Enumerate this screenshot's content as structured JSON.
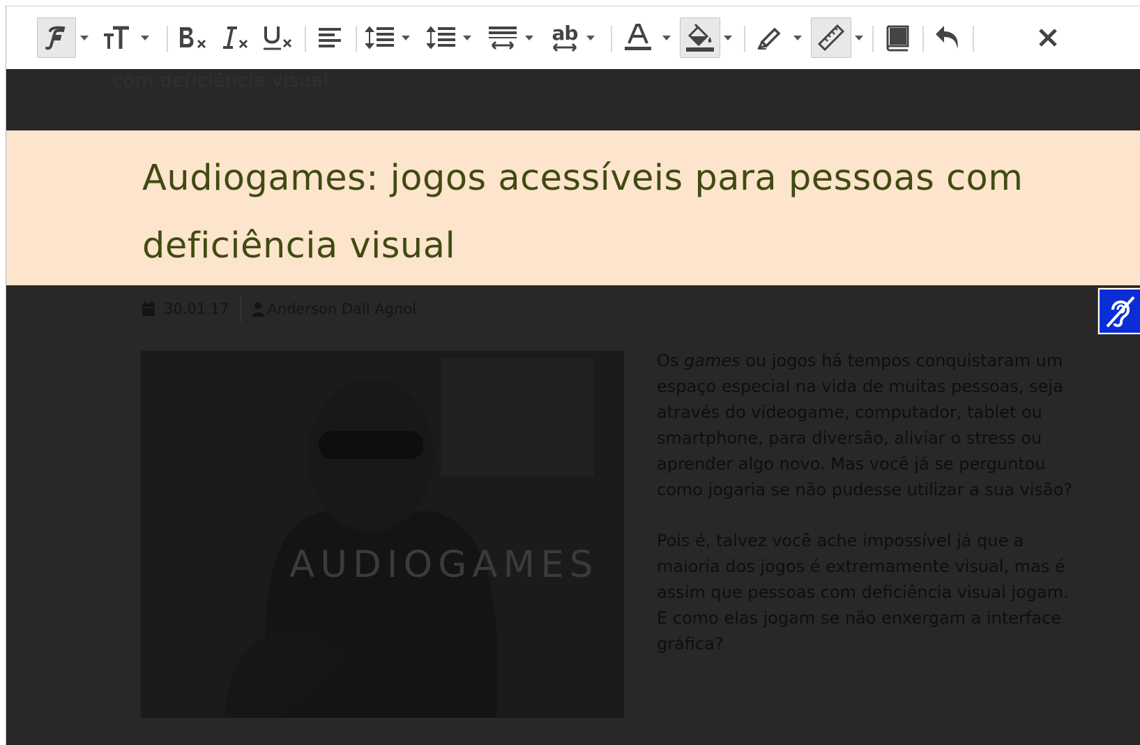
{
  "toolbar": {
    "buttons": [
      {
        "name": "font-family-button",
        "icon": "font-family-icon"
      },
      {
        "name": "font-size-button",
        "icon": "font-size-icon"
      },
      {
        "name": "bold-off-button",
        "icon": "bold-strike-icon"
      },
      {
        "name": "italic-off-button",
        "icon": "italic-strike-icon"
      },
      {
        "name": "underline-off-button",
        "icon": "underline-strike-icon"
      },
      {
        "name": "align-left-button",
        "icon": "align-left-icon"
      },
      {
        "name": "line-spacing-button",
        "icon": "line-spacing-icon"
      },
      {
        "name": "paragraph-spacing-button",
        "icon": "paragraph-spacing-icon"
      },
      {
        "name": "word-spacing-button",
        "icon": "word-spacing-icon"
      },
      {
        "name": "letter-spacing-button",
        "icon": "letter-spacing-icon"
      },
      {
        "name": "text-color-button",
        "icon": "text-color-icon"
      },
      {
        "name": "background-color-button",
        "icon": "fill-color-icon"
      },
      {
        "name": "highlighter-button",
        "icon": "highlighter-icon"
      },
      {
        "name": "reading-ruler-button",
        "icon": "ruler-icon"
      },
      {
        "name": "dictionary-button",
        "icon": "book-icon"
      },
      {
        "name": "undo-button",
        "icon": "undo-icon"
      },
      {
        "name": "close-button",
        "icon": "close-icon"
      }
    ],
    "ab_glyph": "ab"
  },
  "header": {
    "faded_title": "com deficiência visual"
  },
  "article": {
    "title": "Audiogames: jogos acessíveis para pessoas com deficiência visual",
    "date": "30.01.17",
    "author": "Anderson Dall Agnol",
    "image_caption": "AUDIOGAMES",
    "p1_before": "Os ",
    "p1_em": "games",
    "p1_after": " ou jogos há tempos conquistaram um espaço especial na vida de muitas pessoas, seja através do videogame, computador, tablet ou smartphone, para diversão, aliviar o stress ou aprender algo novo. Mas você já se perguntou como jogaria se não pudesse utilizar a sua visão?",
    "p2": "Pois é, talvez você ache impossível já que a maioria dos jogos é extremamente visual, mas é assim que pessoas com deficiência visual jogam. E como elas jogam se não enxergam a interface gráfica?"
  },
  "colors": {
    "toolbar_icon": "#444444",
    "highlight_band": "#fde4cd",
    "title_text": "#3f4b10",
    "page_dim": "#2a2826",
    "accessibility_badge": "#0a2dd6"
  }
}
